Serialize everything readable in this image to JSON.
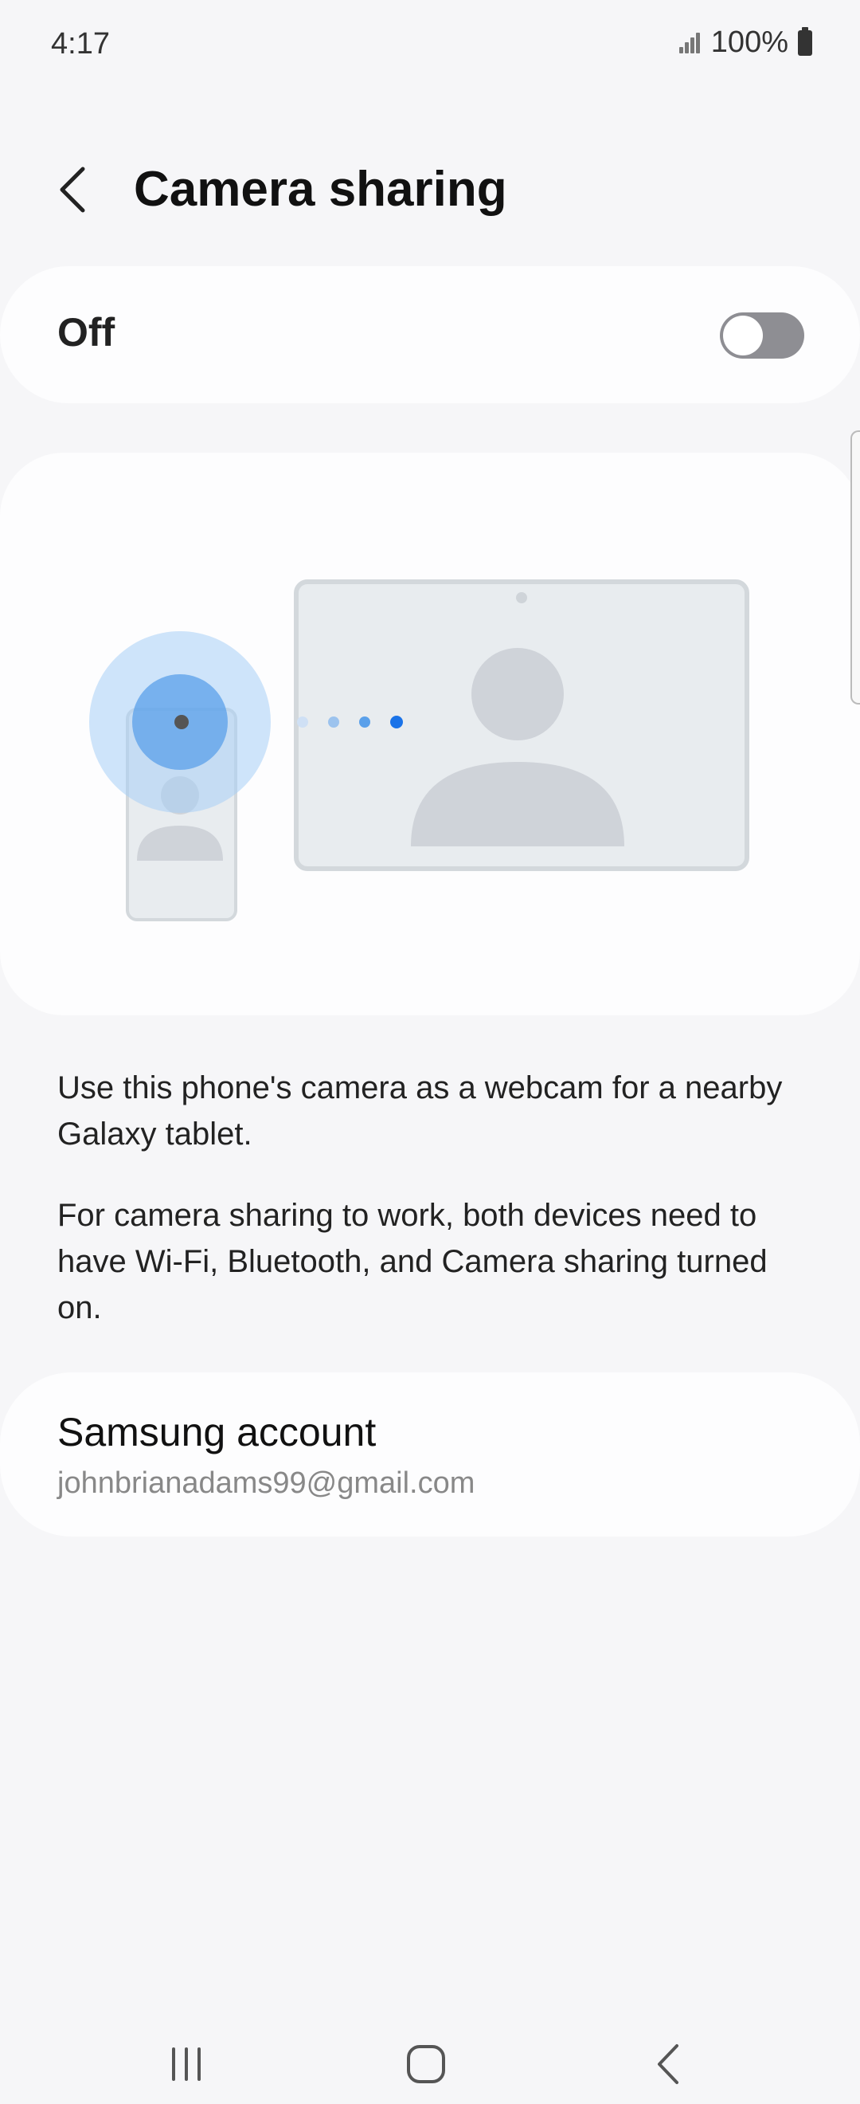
{
  "status_bar": {
    "time": "4:17",
    "battery": "100%",
    "icons": [
      "signal-icon",
      "battery-icon"
    ]
  },
  "header": {
    "back_icon": "chevron-left-icon",
    "title": "Camera sharing"
  },
  "master_toggle": {
    "label": "Off",
    "state": "off"
  },
  "illustration": {
    "description_icons": [
      "phone-icon",
      "tablet-icon",
      "camera-signal-icon"
    ],
    "accent_color": "#1a73e8"
  },
  "description": {
    "line1": "Use this phone's camera as a webcam for a nearby Galaxy tablet.",
    "line2": "For camera sharing to work, both devices need to have Wi-Fi, Bluetooth, and Camera sharing turned on."
  },
  "account": {
    "title": "Samsung account",
    "email": "johnbrianadams99@gmail.com"
  },
  "nav_bar": {
    "recent_icon": "recent-apps-icon",
    "home_icon": "home-icon",
    "back_icon": "back-icon"
  }
}
